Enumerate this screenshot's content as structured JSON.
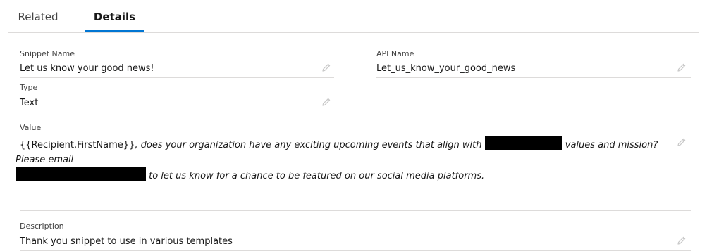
{
  "tabs": [
    {
      "label": "Related",
      "active": false
    },
    {
      "label": "Details",
      "active": true
    }
  ],
  "accent_color": "#0176d3",
  "fields": {
    "snippet_name": {
      "label": "Snippet Name",
      "value": "Let us know your good news!"
    },
    "api_name": {
      "label": "API Name",
      "value": "Let_us_know_your_good_news"
    },
    "type": {
      "label": "Type",
      "value": "Text"
    },
    "value": {
      "label": "Value",
      "merge_field": "{{Recipient.FirstName}}",
      "text_1": ", does your organization have any exciting upcoming events that align with",
      "text_2": "values and mission? Please email",
      "text_3": "to let us know for a chance to be featured on our social media platforms."
    },
    "description": {
      "label": "Description",
      "value": "Thank you snippet to use in various templates"
    }
  },
  "icons": {
    "edit": "pencil-icon"
  }
}
